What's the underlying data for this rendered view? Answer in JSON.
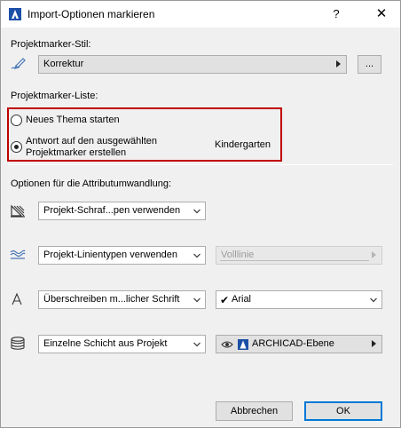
{
  "window": {
    "title": "Import-Optionen markieren",
    "help_label": "?",
    "close_label": "✕"
  },
  "style_section": {
    "label": "Projektmarker-Stil:",
    "dropdown_value": "Korrektur",
    "browse_button": "..."
  },
  "list_section": {
    "label": "Projektmarker-Liste:",
    "radio_new": "Neues Thema starten",
    "radio_reply_line1": "Antwort auf den ausgewählten",
    "radio_reply_line2": "Projektmarker erstellen",
    "selected_marker": "Kindergarten",
    "selected_option": "reply"
  },
  "conversion_section": {
    "label": "Optionen für die Attributumwandlung:",
    "fill_dropdown": "Projekt-Schraf...pen verwenden",
    "line_dropdown": "Projekt-Linientypen verwenden",
    "line_type_value": "Volllinie",
    "font_dropdown": "Überschreiben m...licher Schrift",
    "font_value": "Arial",
    "font_checkmark": "✔",
    "layer_dropdown": "Einzelne Schicht aus Projekt",
    "layer_value": "ARCHICAD-Ebene"
  },
  "footer": {
    "cancel_label": "Abbrechen",
    "ok_label": "OK"
  },
  "icons": {
    "app": "archicad-icon",
    "style": "pen-icon",
    "fill": "hatch-fill-icon",
    "line": "line-type-icon",
    "font": "font-icon",
    "layer": "layers-icon",
    "eye": "eye-icon"
  }
}
